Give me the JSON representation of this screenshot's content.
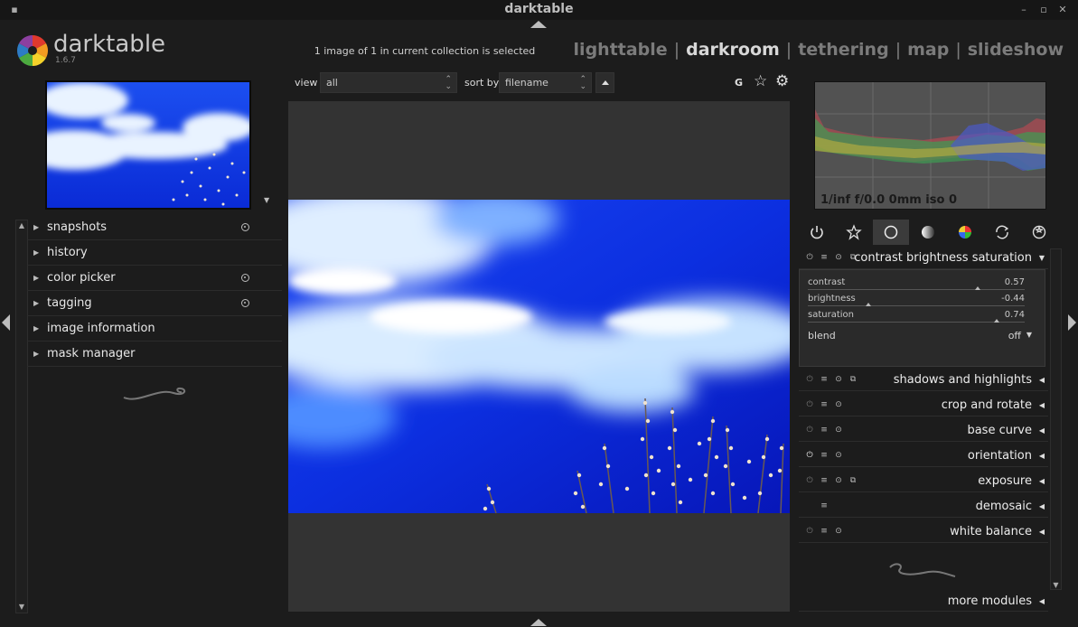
{
  "window": {
    "title": "darktable"
  },
  "header": {
    "app_name": "darktable",
    "version": "1.6.7",
    "collection_info": "1 image of 1 in current collection is selected",
    "views": [
      "lighttable",
      "darkroom",
      "tethering",
      "map",
      "slideshow"
    ],
    "active_view": "darkroom"
  },
  "left_panel": {
    "items": [
      {
        "label": "snapshots",
        "has_indicator": true
      },
      {
        "label": "history",
        "has_indicator": false
      },
      {
        "label": "color picker",
        "has_indicator": true
      },
      {
        "label": "tagging",
        "has_indicator": true
      },
      {
        "label": "image information",
        "has_indicator": false
      },
      {
        "label": "mask manager",
        "has_indicator": false
      }
    ]
  },
  "toolbar": {
    "view_label": "view",
    "view_value": "all",
    "sort_label": "sort by",
    "sort_value": "filename",
    "grouping_label": "G",
    "icons": [
      "star-icon",
      "gear-icon"
    ]
  },
  "histogram": {
    "info": "1/inf f/0.0 0mm iso 0"
  },
  "module_groups": [
    "power-icon",
    "star-icon",
    "circle-icon",
    "tone-icon",
    "color-icon",
    "correct-icon",
    "effect-icon"
  ],
  "active_module": {
    "name": "contrast brightness saturation",
    "sliders": [
      {
        "label": "contrast",
        "value": "0.57",
        "level": 0.785
      },
      {
        "label": "brightness",
        "value": "-0.44",
        "level": 0.28
      },
      {
        "label": "saturation",
        "value": "0.74",
        "level": 0.87
      }
    ],
    "blend_label": "blend",
    "blend_value": "off"
  },
  "modules": [
    {
      "name": "shadows and highlights",
      "presets": true,
      "power": false
    },
    {
      "name": "crop and rotate",
      "presets": false,
      "power": false
    },
    {
      "name": "base curve",
      "presets": false,
      "power": false
    },
    {
      "name": "orientation",
      "presets": false,
      "power": true
    },
    {
      "name": "exposure",
      "presets": true,
      "power": false
    },
    {
      "name": "demosaic",
      "presets": false,
      "power": null
    },
    {
      "name": "white balance",
      "presets": false,
      "power": false
    }
  ],
  "more_modules": "more modules",
  "colors": {
    "sky_blue": "#0a2bd6",
    "bg": "#1c1c1c",
    "image_bg": "#333333"
  }
}
